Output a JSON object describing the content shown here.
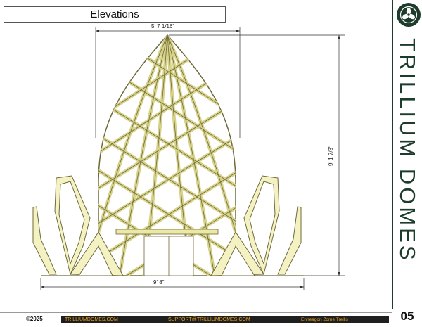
{
  "header": {
    "title": "Elevations"
  },
  "dimensions": {
    "top_width": "5' 7 1/16\"",
    "height": "9' 1 7/8\"",
    "base_width": "9' 8\""
  },
  "brand": {
    "name": "TRILLIUM DOMES",
    "logo": "trillium-flower-icon"
  },
  "footer": {
    "copyright": "©2025",
    "website": "TRILLIUMDOMES.COM",
    "email": "SUPPORT@TRILLIUMDOMES.COM",
    "product": "Enneagon Zome Trellis",
    "page_number": "05"
  },
  "colors": {
    "brand_green": "#1d3c2c",
    "footer_accent": "#f0a31e",
    "wood_fill": "#ece9a6",
    "wood_stroke": "#6f6a3a"
  }
}
